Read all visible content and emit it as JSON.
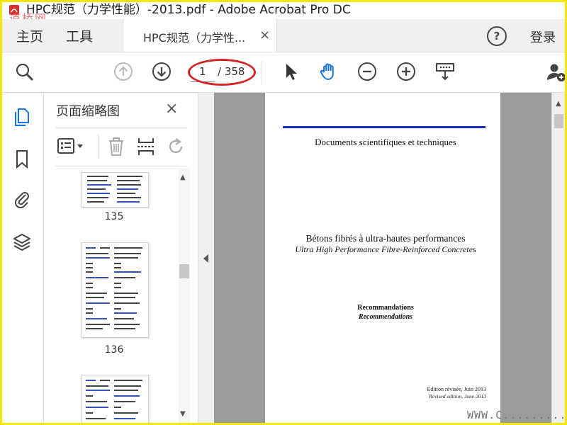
{
  "window": {
    "title": "HPC规范（力学性能）-2013.pdf - Adobe Acrobat Pro DC",
    "watermark_logo": "道桥网"
  },
  "tabs": {
    "home": "主页",
    "tools": "工具",
    "document_tab": "HPC规范（力学性...",
    "close": "×",
    "help": "?",
    "login": "登录"
  },
  "toolbar": {
    "current_page": "1",
    "total_pages": "/ 358"
  },
  "thumbnails": {
    "title": "页面缩略图",
    "close": "×",
    "pages": [
      "135",
      "136"
    ]
  },
  "document": {
    "header": "Documents scientifiques et techniques",
    "title_fr": "Bétons fibrés à ultra-hautes performances",
    "title_en": "Ultra High Performance Fibre-Reinforced Concretes",
    "sub_fr": "Recommandations",
    "sub_en": "Recommendations",
    "edition_fr": "Edition révisée, Juin 2013",
    "edition_en": "Revised edition, June 2013"
  },
  "footer": {
    "watermark": "WWW.C..........M"
  },
  "colors": {
    "accent": "#1473e6",
    "frame": "#f3e600",
    "highlight_oval": "#d42424",
    "doc_rule": "#1a2ec0"
  },
  "icons": {
    "rail": [
      "pages-icon",
      "bookmark-icon",
      "attachment-icon",
      "layers-icon"
    ],
    "toolbar": [
      "search-icon",
      "arrow-up-icon",
      "arrow-down-icon",
      "select-cursor-icon",
      "hand-tool-icon",
      "zoom-out-icon",
      "zoom-in-icon",
      "scroll-mode-icon",
      "share-user-icon"
    ]
  }
}
